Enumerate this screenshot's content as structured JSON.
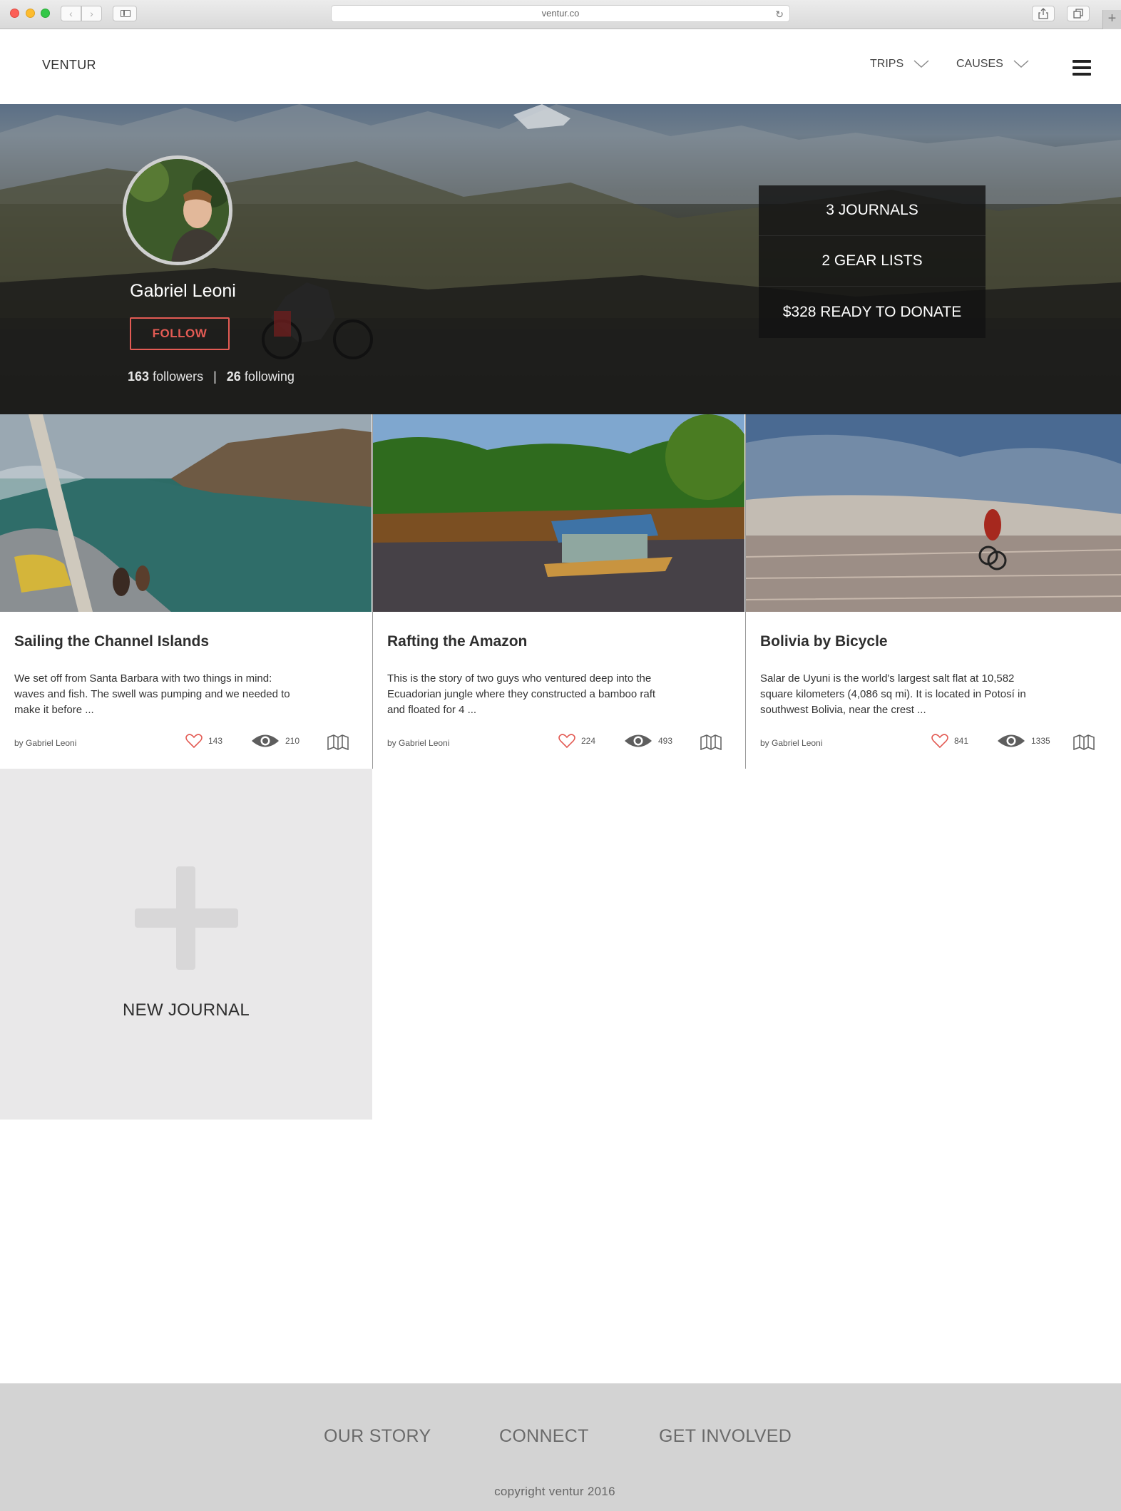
{
  "browser": {
    "url": "ventur.co"
  },
  "header": {
    "logo": "VENTUR",
    "nav": [
      {
        "label": "TRIPS"
      },
      {
        "label": "CAUSES"
      }
    ]
  },
  "profile": {
    "name": "Gabriel Leoni",
    "follow_label": "FOLLOW",
    "followers_count": "163",
    "followers_label": "followers",
    "separator": "|",
    "following_count": "26",
    "following_label": "following",
    "stats": [
      {
        "label": "3 JOURNALS"
      },
      {
        "label": "2 GEAR LISTS"
      },
      {
        "label": "$328 READY TO DONATE"
      }
    ]
  },
  "journals": [
    {
      "title": "Sailing the Channel Islands",
      "description": "We set off from Santa Barbara with two things in mind: waves and fish. The swell was pumping and we needed to make it before  ...",
      "author": "by Gabriel Leoni",
      "likes": "143",
      "views": "210"
    },
    {
      "title": "Rafting the Amazon",
      "description": "This is the story of two guys who ventured deep into the Ecuadorian jungle where they constructed a bamboo raft and floated for 4 ...",
      "author": "by Gabriel Leoni",
      "likes": "224",
      "views": "493"
    },
    {
      "title": "Bolivia by Bicycle",
      "description": "Salar de Uyuni is the world's largest salt flat at 10,582 square kilometers (4,086 sq mi). It is located  in Potosí in southwest Bolivia, near the crest ...",
      "author": "by Gabriel Leoni",
      "likes": "841",
      "views": "1335"
    }
  ],
  "new_journal": {
    "label": "NEW JOURNAL"
  },
  "footer": {
    "links": [
      {
        "label": "OUR STORY"
      },
      {
        "label": "CONNECT"
      },
      {
        "label": "GET INVOLVED"
      }
    ],
    "copyright": "copyright ventur 2016"
  },
  "colors": {
    "accent": "#e35b54",
    "footer_bg": "#d3d3d3",
    "new_journal_bg": "#e9e8e9"
  },
  "icons": {
    "like": "heart-icon",
    "views": "eye-icon",
    "map": "map-icon",
    "menu": "hamburger-icon",
    "dropdown": "chevron-down-icon",
    "add": "plus-icon"
  }
}
